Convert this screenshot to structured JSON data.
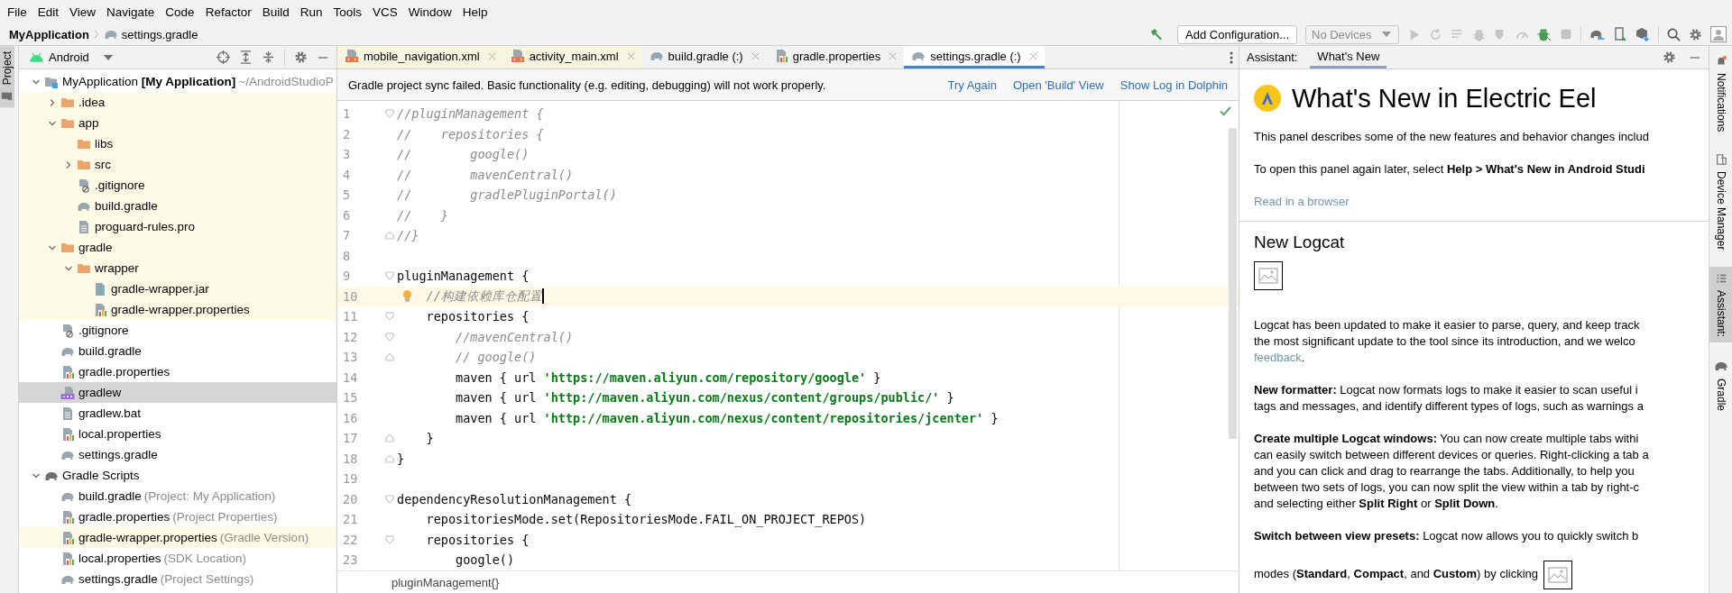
{
  "menu": [
    "File",
    "Edit",
    "View",
    "Navigate",
    "Code",
    "Refactor",
    "Build",
    "Run",
    "Tools",
    "VCS",
    "Window",
    "Help"
  ],
  "breadcrumb": [
    {
      "label": "MyApplication",
      "kind": "project"
    },
    {
      "label": "settings.gradle",
      "kind": "gradle"
    }
  ],
  "toolbar": {
    "run_config": "Add Configuration...",
    "device": {
      "label": "No Devices",
      "disabled": true
    }
  },
  "left_stripe": [
    {
      "label": "Project",
      "selected": true
    }
  ],
  "project_panel": {
    "view": "Android",
    "tree": [
      {
        "name": "MyApplication **[My Application]**",
        "hint": "~/AndroidStudioP",
        "kind": "module",
        "expanded": true,
        "selected": false,
        "highlighted": false,
        "children": [
          {
            "name": ".idea",
            "kind": "folder",
            "expanded": false,
            "selected": false,
            "highlighted": true
          },
          {
            "name": "app",
            "kind": "folder",
            "expanded": true,
            "selected": false,
            "highlighted": true,
            "children": [
              {
                "name": "libs",
                "kind": "folder",
                "selected": false,
                "highlighted": true
              },
              {
                "name": "src",
                "kind": "folder",
                "expanded": false,
                "selected": false,
                "highlighted": true
              },
              {
                "name": ".gitignore",
                "kind": "gitignore",
                "selected": false,
                "highlighted": true
              },
              {
                "name": "build.gradle",
                "kind": "gradle",
                "selected": false,
                "highlighted": true
              },
              {
                "name": "proguard-rules.pro",
                "kind": "text",
                "selected": false,
                "highlighted": true
              }
            ]
          },
          {
            "name": "gradle",
            "kind": "folder",
            "expanded": true,
            "selected": false,
            "highlighted": true,
            "children": [
              {
                "name": "wrapper",
                "kind": "folder",
                "expanded": true,
                "selected": false,
                "highlighted": true,
                "children": [
                  {
                    "name": "gradle-wrapper.jar",
                    "kind": "jar",
                    "selected": false,
                    "highlighted": true
                  },
                  {
                    "name": "gradle-wrapper.properties",
                    "kind": "properties",
                    "selected": false,
                    "highlighted": true
                  }
                ]
              }
            ]
          },
          {
            "name": ".gitignore",
            "kind": "gitignore",
            "selected": false,
            "highlighted": false
          },
          {
            "name": "build.gradle",
            "kind": "gradle",
            "selected": false,
            "highlighted": false
          },
          {
            "name": "gradle.properties",
            "kind": "properties",
            "selected": false,
            "highlighted": false
          },
          {
            "name": "gradlew",
            "kind": "script",
            "selected": true,
            "highlighted": false
          },
          {
            "name": "gradlew.bat",
            "kind": "text",
            "selected": false,
            "highlighted": false
          },
          {
            "name": "local.properties",
            "kind": "properties",
            "selected": false,
            "highlighted": false
          },
          {
            "name": "settings.gradle",
            "kind": "gradle",
            "selected": false,
            "highlighted": false
          }
        ]
      },
      {
        "name": "Gradle Scripts",
        "kind": "gradle-scripts",
        "expanded": true,
        "selected": false,
        "highlighted": false,
        "children": [
          {
            "name": "build.gradle",
            "hint": "(Project: My Application)",
            "kind": "gradle",
            "selected": false,
            "highlighted": false
          },
          {
            "name": "gradle.properties",
            "hint": "(Project Properties)",
            "kind": "properties",
            "selected": false,
            "highlighted": false
          },
          {
            "name": "gradle-wrapper.properties",
            "hint": "(Gradle Version)",
            "kind": "properties",
            "selected": false,
            "highlighted": true
          },
          {
            "name": "local.properties",
            "hint": "(SDK Location)",
            "kind": "properties",
            "selected": false,
            "highlighted": false
          },
          {
            "name": "settings.gradle",
            "hint": "(Project Settings)",
            "kind": "gradle",
            "selected": false,
            "highlighted": false
          }
        ]
      }
    ]
  },
  "editor": {
    "tabs": [
      {
        "label": "mobile_navigation.xml",
        "kind": "xml",
        "selected": false,
        "highlighted": true
      },
      {
        "label": "activity_main.xml",
        "kind": "xml",
        "selected": false,
        "highlighted": true
      },
      {
        "label": "build.gradle (:)",
        "kind": "gradle",
        "selected": false,
        "highlighted": false
      },
      {
        "label": "gradle.properties",
        "kind": "properties",
        "selected": false,
        "highlighted": false
      },
      {
        "label": "settings.gradle (:)",
        "kind": "gradle",
        "selected": true,
        "highlighted": false
      }
    ],
    "banner": {
      "message": "Gradle project sync failed. Basic functionality (e.g. editing, debugging) will not work properly.",
      "links": [
        "Try Again",
        "Open 'Build' View",
        "Show Log in Dolphin"
      ]
    },
    "lines": [
      {
        "number": "1",
        "kind": "fold-start",
        "current": false,
        "tokens": [
          {
            "text": "//pluginManagement {",
            "kind": "comment"
          }
        ]
      },
      {
        "number": "2",
        "kind": "plain",
        "current": false,
        "tokens": [
          {
            "text": "//    repositories {",
            "kind": "comment"
          }
        ]
      },
      {
        "number": "3",
        "kind": "plain",
        "current": false,
        "tokens": [
          {
            "text": "//        google()",
            "kind": "comment"
          }
        ]
      },
      {
        "number": "4",
        "kind": "plain",
        "current": false,
        "tokens": [
          {
            "text": "//        mavenCentral()",
            "kind": "comment"
          }
        ]
      },
      {
        "number": "5",
        "kind": "plain",
        "current": false,
        "tokens": [
          {
            "text": "//        gradlePluginPortal()",
            "kind": "comment"
          }
        ]
      },
      {
        "number": "6",
        "kind": "plain",
        "current": false,
        "tokens": [
          {
            "text": "//    }",
            "kind": "comment"
          }
        ]
      },
      {
        "number": "7",
        "kind": "fold-end",
        "current": false,
        "tokens": [
          {
            "text": "//}",
            "kind": "comment"
          }
        ]
      },
      {
        "number": "8",
        "kind": "plain",
        "current": false
      },
      {
        "number": "9",
        "kind": "fold-start",
        "current": false,
        "tokens": [
          {
            "text": "pluginManagement {",
            "kind": "plain"
          }
        ]
      },
      {
        "number": "10",
        "kind": "plain",
        "current": true,
        "tokens": [
          {
            "text": "    //构建依赖库仓配置",
            "kind": "comment"
          }
        ]
      },
      {
        "number": "11",
        "kind": "fold-start",
        "current": false,
        "tokens": [
          {
            "text": "    repositories {",
            "kind": "plain"
          }
        ]
      },
      {
        "number": "12",
        "kind": "fold-start",
        "current": false,
        "tokens": [
          {
            "text": "        //mavenCentral()",
            "kind": "comment"
          }
        ]
      },
      {
        "number": "13",
        "kind": "fold-end",
        "current": false,
        "tokens": [
          {
            "text": "        // google()",
            "kind": "comment"
          }
        ]
      },
      {
        "number": "14",
        "kind": "plain",
        "current": false,
        "tokens": [
          {
            "text": "        maven { url ",
            "kind": "plain"
          },
          {
            "text": "'https://maven.aliyun.com/repository/google'",
            "kind": "string"
          },
          {
            "text": " }",
            "kind": "plain"
          }
        ]
      },
      {
        "number": "15",
        "kind": "plain",
        "current": false,
        "tokens": [
          {
            "text": "        maven { url ",
            "kind": "plain"
          },
          {
            "text": "'http://maven.aliyun.com/nexus/content/groups/public/'",
            "kind": "string"
          },
          {
            "text": " }",
            "kind": "plain"
          }
        ]
      },
      {
        "number": "16",
        "kind": "plain",
        "current": false,
        "tokens": [
          {
            "text": "        maven { url ",
            "kind": "plain"
          },
          {
            "text": "'http://maven.aliyun.com/nexus/content/repositories/jcenter'",
            "kind": "string"
          },
          {
            "text": " }",
            "kind": "plain"
          }
        ]
      },
      {
        "number": "17",
        "kind": "fold-end",
        "current": false,
        "tokens": [
          {
            "text": "    }",
            "kind": "plain"
          }
        ]
      },
      {
        "number": "18",
        "kind": "fold-end",
        "current": false,
        "tokens": [
          {
            "text": "}",
            "kind": "plain"
          }
        ]
      },
      {
        "number": "19",
        "kind": "plain",
        "current": false
      },
      {
        "number": "20",
        "kind": "fold-start",
        "current": false,
        "tokens": [
          {
            "text": "dependencyResolutionManagement {",
            "kind": "plain"
          }
        ]
      },
      {
        "number": "21",
        "kind": "plain",
        "current": false,
        "tokens": [
          {
            "text": "    repositoriesMode.set(RepositoriesMode.FAIL_ON_PROJECT_REPOS)",
            "kind": "plain"
          }
        ]
      },
      {
        "number": "22",
        "kind": "fold-start",
        "current": false,
        "tokens": [
          {
            "text": "    repositories {",
            "kind": "plain"
          }
        ]
      },
      {
        "number": "23",
        "kind": "plain",
        "current": false,
        "tokens": [
          {
            "text": "        google()",
            "kind": "plain"
          }
        ]
      }
    ],
    "breadcrumb": "pluginManagement{}"
  },
  "assistant": {
    "label": "Assistant:",
    "tabs": [
      {
        "label": "What's New",
        "selected": true
      }
    ],
    "title": "What's New in Electric Eel",
    "blocks": [
      {
        "kind": "paragraph",
        "lines": [
          "This panel describes some of the new features and behavior changes includ"
        ]
      },
      {
        "kind": "paragraph",
        "lines": [
          "To open this panel again later, select **Help > What's New in Android Studi**"
        ]
      },
      {
        "kind": "link",
        "text": "Read in a browser"
      },
      {
        "kind": "rule"
      },
      {
        "kind": "heading",
        "text": "New Logcat"
      },
      {
        "kind": "image"
      },
      {
        "kind": "paragraph",
        "lines": [
          "Logcat has been updated to make it easier to parse, query, and keep track",
          "the most significant update to the tool since its introduction, and we welco"
        ],
        "link": "feedback",
        "after": "."
      },
      {
        "kind": "paragraph",
        "lines": [
          "**New formatter:** Logcat now formats logs to make it easier to scan useful i",
          "tags and messages, and identify different types of logs, such as warnings a"
        ]
      },
      {
        "kind": "paragraph",
        "lines": [
          "**Create multiple Logcat windows:** You can now create multiple tabs withi",
          "can easily switch between different devices or queries. Right-clicking a tab a",
          "and you can click and drag to rearrange the tabs. Additionally, to help you",
          "between two sets of logs, you can now split the view within a tab by right-c",
          "and selecting either **Split Right** or **Split Down**."
        ]
      },
      {
        "kind": "paragraph",
        "lines": [
          "**Switch between view presets:** Logcat now allows you to quickly switch b"
        ]
      },
      {
        "kind": "paragraph",
        "lines": [
          "modes (**Standard**, **Compact**, and **Custom**) by clicking"
        ],
        "image": true
      }
    ]
  },
  "right_stripe": [
    {
      "label": "Notifications",
      "kind": "bell",
      "selected": false
    },
    {
      "label": "Device Manager",
      "kind": "device",
      "selected": false
    },
    {
      "label": "Assistant:",
      "kind": "list",
      "selected": true
    },
    {
      "label": "Gradle",
      "kind": "gradle",
      "selected": false
    }
  ]
}
